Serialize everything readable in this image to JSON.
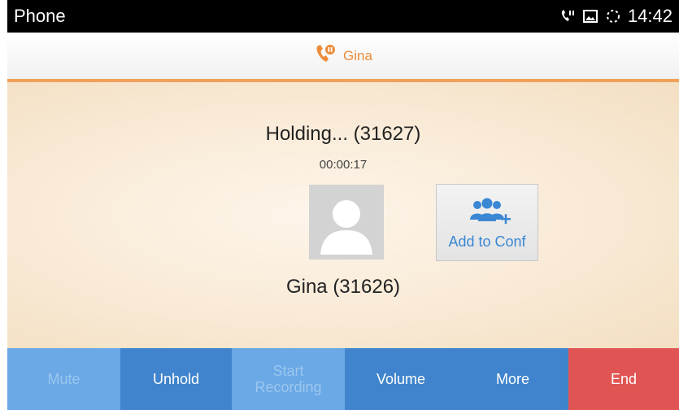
{
  "status_bar": {
    "app_name": "Phone",
    "time": "14:42",
    "icons": [
      "call-hold-icon",
      "picture-icon",
      "sync-icon"
    ]
  },
  "call_header": {
    "contact_name": "Gina",
    "icon": "call-hold-icon",
    "accent_color": "#ec8c3b"
  },
  "call": {
    "status_text": "Holding... (31627)",
    "timer": "00:00:17",
    "contact_label": "Gina (31626)"
  },
  "add_to_conf": {
    "label": "Add to Conf",
    "icon": "add-conference-icon"
  },
  "toolbar": {
    "mute": "Mute",
    "unhold": "Unhold",
    "start_recording": "Start Recording",
    "volume": "Volume",
    "more": "More",
    "end": "End"
  },
  "colors": {
    "button_light": "#6aa8e6",
    "button_dark": "#3f84cc",
    "end": "#e05553"
  }
}
